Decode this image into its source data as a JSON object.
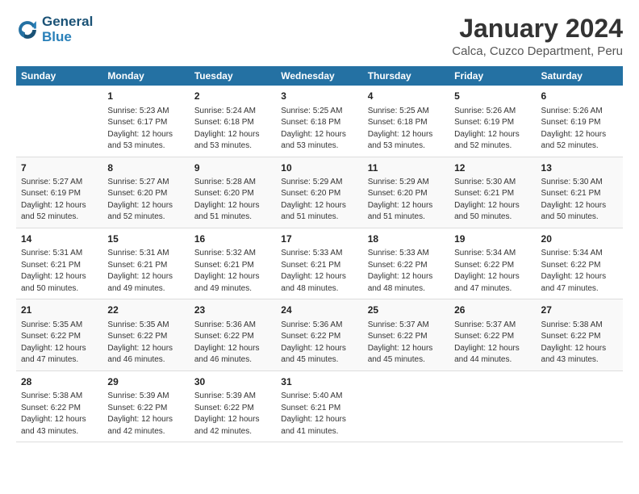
{
  "logo": {
    "line1": "General",
    "line2": "Blue"
  },
  "title": "January 2024",
  "subtitle": "Calca, Cuzco Department, Peru",
  "days_header": [
    "Sunday",
    "Monday",
    "Tuesday",
    "Wednesday",
    "Thursday",
    "Friday",
    "Saturday"
  ],
  "weeks": [
    [
      {
        "num": "",
        "sunrise": "",
        "sunset": "",
        "daylight": ""
      },
      {
        "num": "1",
        "sunrise": "Sunrise: 5:23 AM",
        "sunset": "Sunset: 6:17 PM",
        "daylight": "Daylight: 12 hours and 53 minutes."
      },
      {
        "num": "2",
        "sunrise": "Sunrise: 5:24 AM",
        "sunset": "Sunset: 6:18 PM",
        "daylight": "Daylight: 12 hours and 53 minutes."
      },
      {
        "num": "3",
        "sunrise": "Sunrise: 5:25 AM",
        "sunset": "Sunset: 6:18 PM",
        "daylight": "Daylight: 12 hours and 53 minutes."
      },
      {
        "num": "4",
        "sunrise": "Sunrise: 5:25 AM",
        "sunset": "Sunset: 6:18 PM",
        "daylight": "Daylight: 12 hours and 53 minutes."
      },
      {
        "num": "5",
        "sunrise": "Sunrise: 5:26 AM",
        "sunset": "Sunset: 6:19 PM",
        "daylight": "Daylight: 12 hours and 52 minutes."
      },
      {
        "num": "6",
        "sunrise": "Sunrise: 5:26 AM",
        "sunset": "Sunset: 6:19 PM",
        "daylight": "Daylight: 12 hours and 52 minutes."
      }
    ],
    [
      {
        "num": "7",
        "sunrise": "Sunrise: 5:27 AM",
        "sunset": "Sunset: 6:19 PM",
        "daylight": "Daylight: 12 hours and 52 minutes."
      },
      {
        "num": "8",
        "sunrise": "Sunrise: 5:27 AM",
        "sunset": "Sunset: 6:20 PM",
        "daylight": "Daylight: 12 hours and 52 minutes."
      },
      {
        "num": "9",
        "sunrise": "Sunrise: 5:28 AM",
        "sunset": "Sunset: 6:20 PM",
        "daylight": "Daylight: 12 hours and 51 minutes."
      },
      {
        "num": "10",
        "sunrise": "Sunrise: 5:29 AM",
        "sunset": "Sunset: 6:20 PM",
        "daylight": "Daylight: 12 hours and 51 minutes."
      },
      {
        "num": "11",
        "sunrise": "Sunrise: 5:29 AM",
        "sunset": "Sunset: 6:20 PM",
        "daylight": "Daylight: 12 hours and 51 minutes."
      },
      {
        "num": "12",
        "sunrise": "Sunrise: 5:30 AM",
        "sunset": "Sunset: 6:21 PM",
        "daylight": "Daylight: 12 hours and 50 minutes."
      },
      {
        "num": "13",
        "sunrise": "Sunrise: 5:30 AM",
        "sunset": "Sunset: 6:21 PM",
        "daylight": "Daylight: 12 hours and 50 minutes."
      }
    ],
    [
      {
        "num": "14",
        "sunrise": "Sunrise: 5:31 AM",
        "sunset": "Sunset: 6:21 PM",
        "daylight": "Daylight: 12 hours and 50 minutes."
      },
      {
        "num": "15",
        "sunrise": "Sunrise: 5:31 AM",
        "sunset": "Sunset: 6:21 PM",
        "daylight": "Daylight: 12 hours and 49 minutes."
      },
      {
        "num": "16",
        "sunrise": "Sunrise: 5:32 AM",
        "sunset": "Sunset: 6:21 PM",
        "daylight": "Daylight: 12 hours and 49 minutes."
      },
      {
        "num": "17",
        "sunrise": "Sunrise: 5:33 AM",
        "sunset": "Sunset: 6:21 PM",
        "daylight": "Daylight: 12 hours and 48 minutes."
      },
      {
        "num": "18",
        "sunrise": "Sunrise: 5:33 AM",
        "sunset": "Sunset: 6:22 PM",
        "daylight": "Daylight: 12 hours and 48 minutes."
      },
      {
        "num": "19",
        "sunrise": "Sunrise: 5:34 AM",
        "sunset": "Sunset: 6:22 PM",
        "daylight": "Daylight: 12 hours and 47 minutes."
      },
      {
        "num": "20",
        "sunrise": "Sunrise: 5:34 AM",
        "sunset": "Sunset: 6:22 PM",
        "daylight": "Daylight: 12 hours and 47 minutes."
      }
    ],
    [
      {
        "num": "21",
        "sunrise": "Sunrise: 5:35 AM",
        "sunset": "Sunset: 6:22 PM",
        "daylight": "Daylight: 12 hours and 47 minutes."
      },
      {
        "num": "22",
        "sunrise": "Sunrise: 5:35 AM",
        "sunset": "Sunset: 6:22 PM",
        "daylight": "Daylight: 12 hours and 46 minutes."
      },
      {
        "num": "23",
        "sunrise": "Sunrise: 5:36 AM",
        "sunset": "Sunset: 6:22 PM",
        "daylight": "Daylight: 12 hours and 46 minutes."
      },
      {
        "num": "24",
        "sunrise": "Sunrise: 5:36 AM",
        "sunset": "Sunset: 6:22 PM",
        "daylight": "Daylight: 12 hours and 45 minutes."
      },
      {
        "num": "25",
        "sunrise": "Sunrise: 5:37 AM",
        "sunset": "Sunset: 6:22 PM",
        "daylight": "Daylight: 12 hours and 45 minutes."
      },
      {
        "num": "26",
        "sunrise": "Sunrise: 5:37 AM",
        "sunset": "Sunset: 6:22 PM",
        "daylight": "Daylight: 12 hours and 44 minutes."
      },
      {
        "num": "27",
        "sunrise": "Sunrise: 5:38 AM",
        "sunset": "Sunset: 6:22 PM",
        "daylight": "Daylight: 12 hours and 43 minutes."
      }
    ],
    [
      {
        "num": "28",
        "sunrise": "Sunrise: 5:38 AM",
        "sunset": "Sunset: 6:22 PM",
        "daylight": "Daylight: 12 hours and 43 minutes."
      },
      {
        "num": "29",
        "sunrise": "Sunrise: 5:39 AM",
        "sunset": "Sunset: 6:22 PM",
        "daylight": "Daylight: 12 hours and 42 minutes."
      },
      {
        "num": "30",
        "sunrise": "Sunrise: 5:39 AM",
        "sunset": "Sunset: 6:22 PM",
        "daylight": "Daylight: 12 hours and 42 minutes."
      },
      {
        "num": "31",
        "sunrise": "Sunrise: 5:40 AM",
        "sunset": "Sunset: 6:21 PM",
        "daylight": "Daylight: 12 hours and 41 minutes."
      },
      {
        "num": "",
        "sunrise": "",
        "sunset": "",
        "daylight": ""
      },
      {
        "num": "",
        "sunrise": "",
        "sunset": "",
        "daylight": ""
      },
      {
        "num": "",
        "sunrise": "",
        "sunset": "",
        "daylight": ""
      }
    ]
  ]
}
